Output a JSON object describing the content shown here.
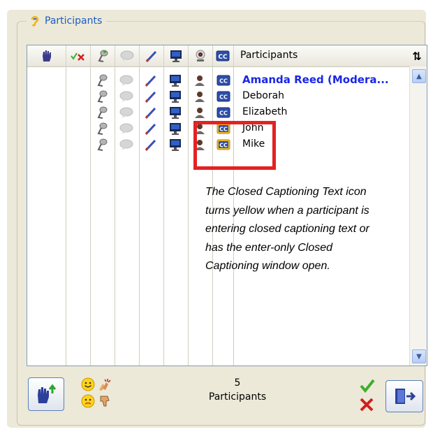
{
  "group": {
    "title": "Participants"
  },
  "header": {
    "column_title": "Participants",
    "icons": [
      "raise-hand-icon",
      "status-check-x-icon",
      "microphone-icon",
      "chat-icon",
      "pen-icon",
      "monitor-icon",
      "webcam-icon",
      "closed-captioning-icon"
    ],
    "sort_icon": "sort-arrows-icon"
  },
  "participants": [
    {
      "name": "Amanda Reed (Modera...",
      "moderator": true,
      "cc_active": false
    },
    {
      "name": "Deborah",
      "moderator": false,
      "cc_active": false
    },
    {
      "name": "Elizabeth",
      "moderator": false,
      "cc_active": false
    },
    {
      "name": "John",
      "moderator": false,
      "cc_active": true
    },
    {
      "name": "Mike",
      "moderator": false,
      "cc_active": true
    }
  ],
  "annotation": "The Closed Captioning Text icon turns yellow when a participant is entering closed captioning text or has the enter-only Closed Captioning window open.",
  "footer": {
    "count": "5",
    "count_label": "Participants"
  },
  "colors": {
    "moderator_name": "#1a26e6",
    "highlight_box": "#e32222",
    "cc_active_bg": "#f6c21c",
    "cc_default_bg": "#2d4ea8"
  }
}
